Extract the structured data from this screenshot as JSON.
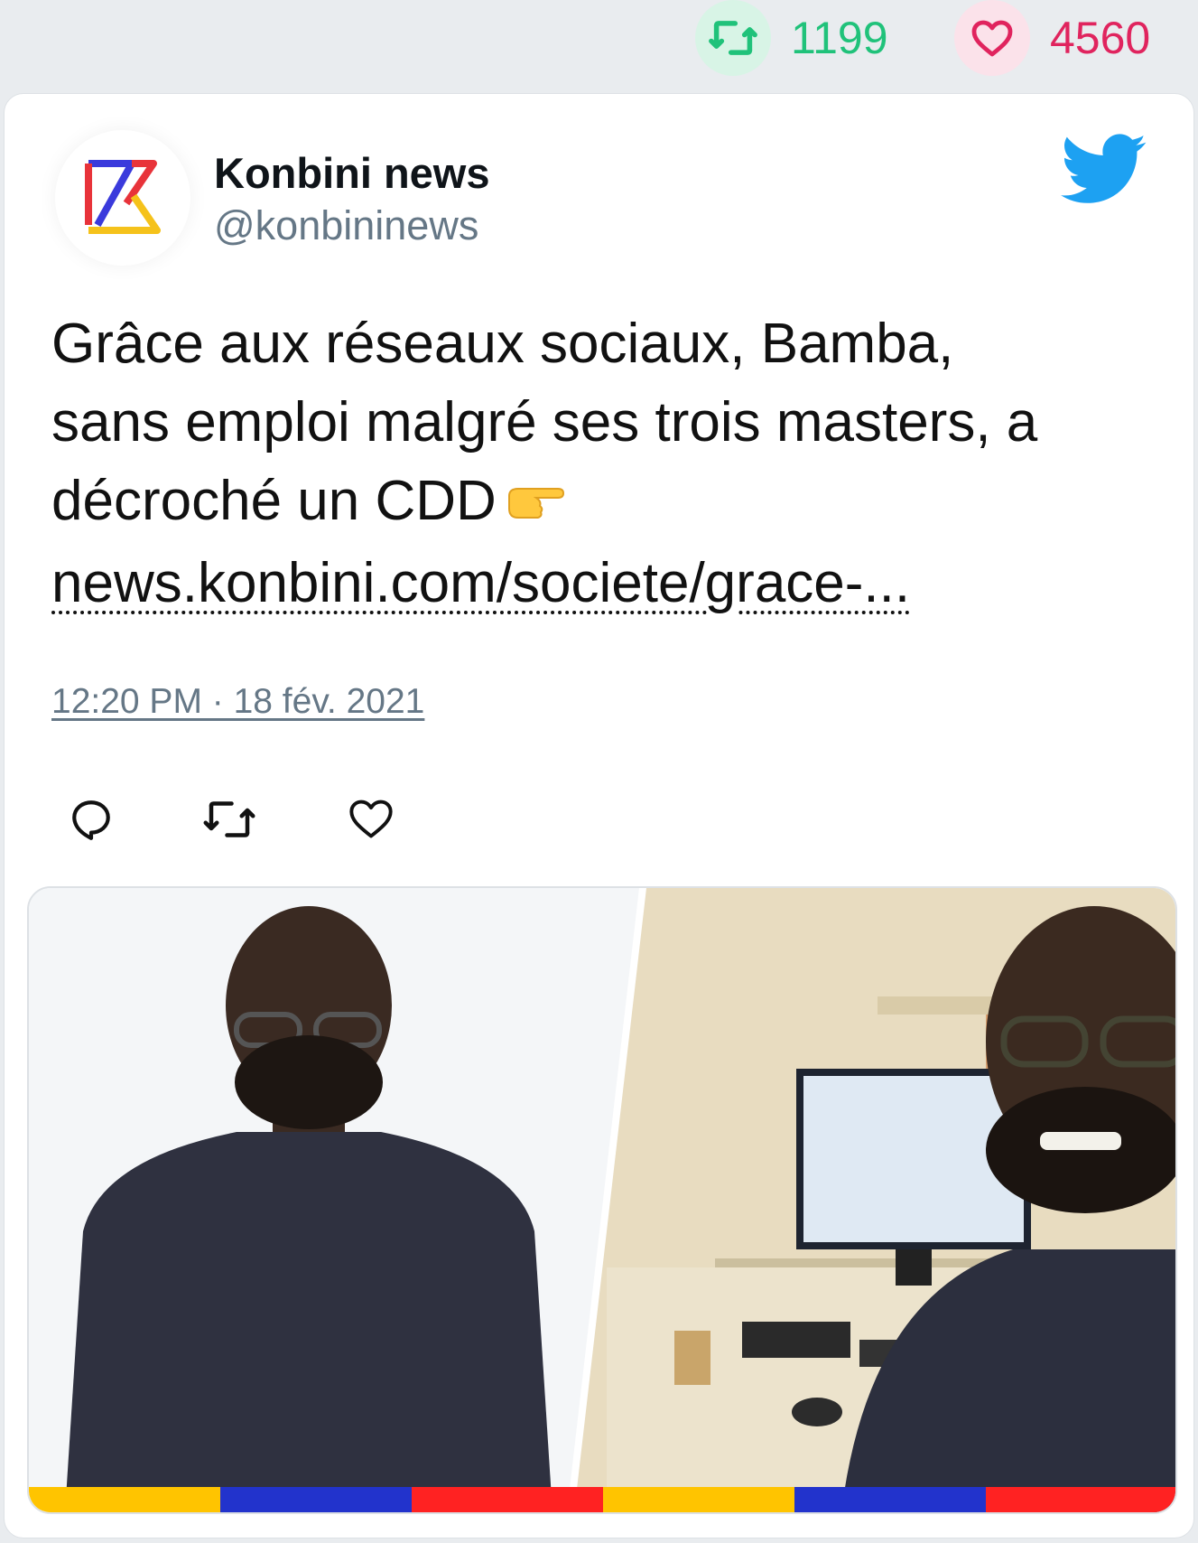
{
  "stats": {
    "retweets": "1199",
    "likes": "4560",
    "retweet_icon": "retweet-icon",
    "like_icon": "heart-icon",
    "retweet_color": "#20c27a",
    "like_color": "#e0245e"
  },
  "tweet": {
    "author_name": "Konbini news",
    "author_handle": "@konbininews",
    "text_line1": "Grâce aux réseaux sociaux, Bamba,",
    "text_line2": "sans emploi malgré ses trois masters, a",
    "text_line3": "décroché un CDD",
    "emoji": "backhand-index-pointing-right",
    "link": "news.konbini.com/societe/grace-...",
    "timestamp": "12:20 PM · 18 fév. 2021",
    "actions": [
      "reply-icon",
      "retweet-icon",
      "heart-icon"
    ],
    "brand_icon": "twitter-bird-icon",
    "brand_color": "#1da1f2"
  },
  "media": {
    "description_icon": "photo",
    "stripe_colors": [
      "#ffc400",
      "#2233cc",
      "#ff2222",
      "#ffc400",
      "#2233cc",
      "#ff2222"
    ]
  }
}
